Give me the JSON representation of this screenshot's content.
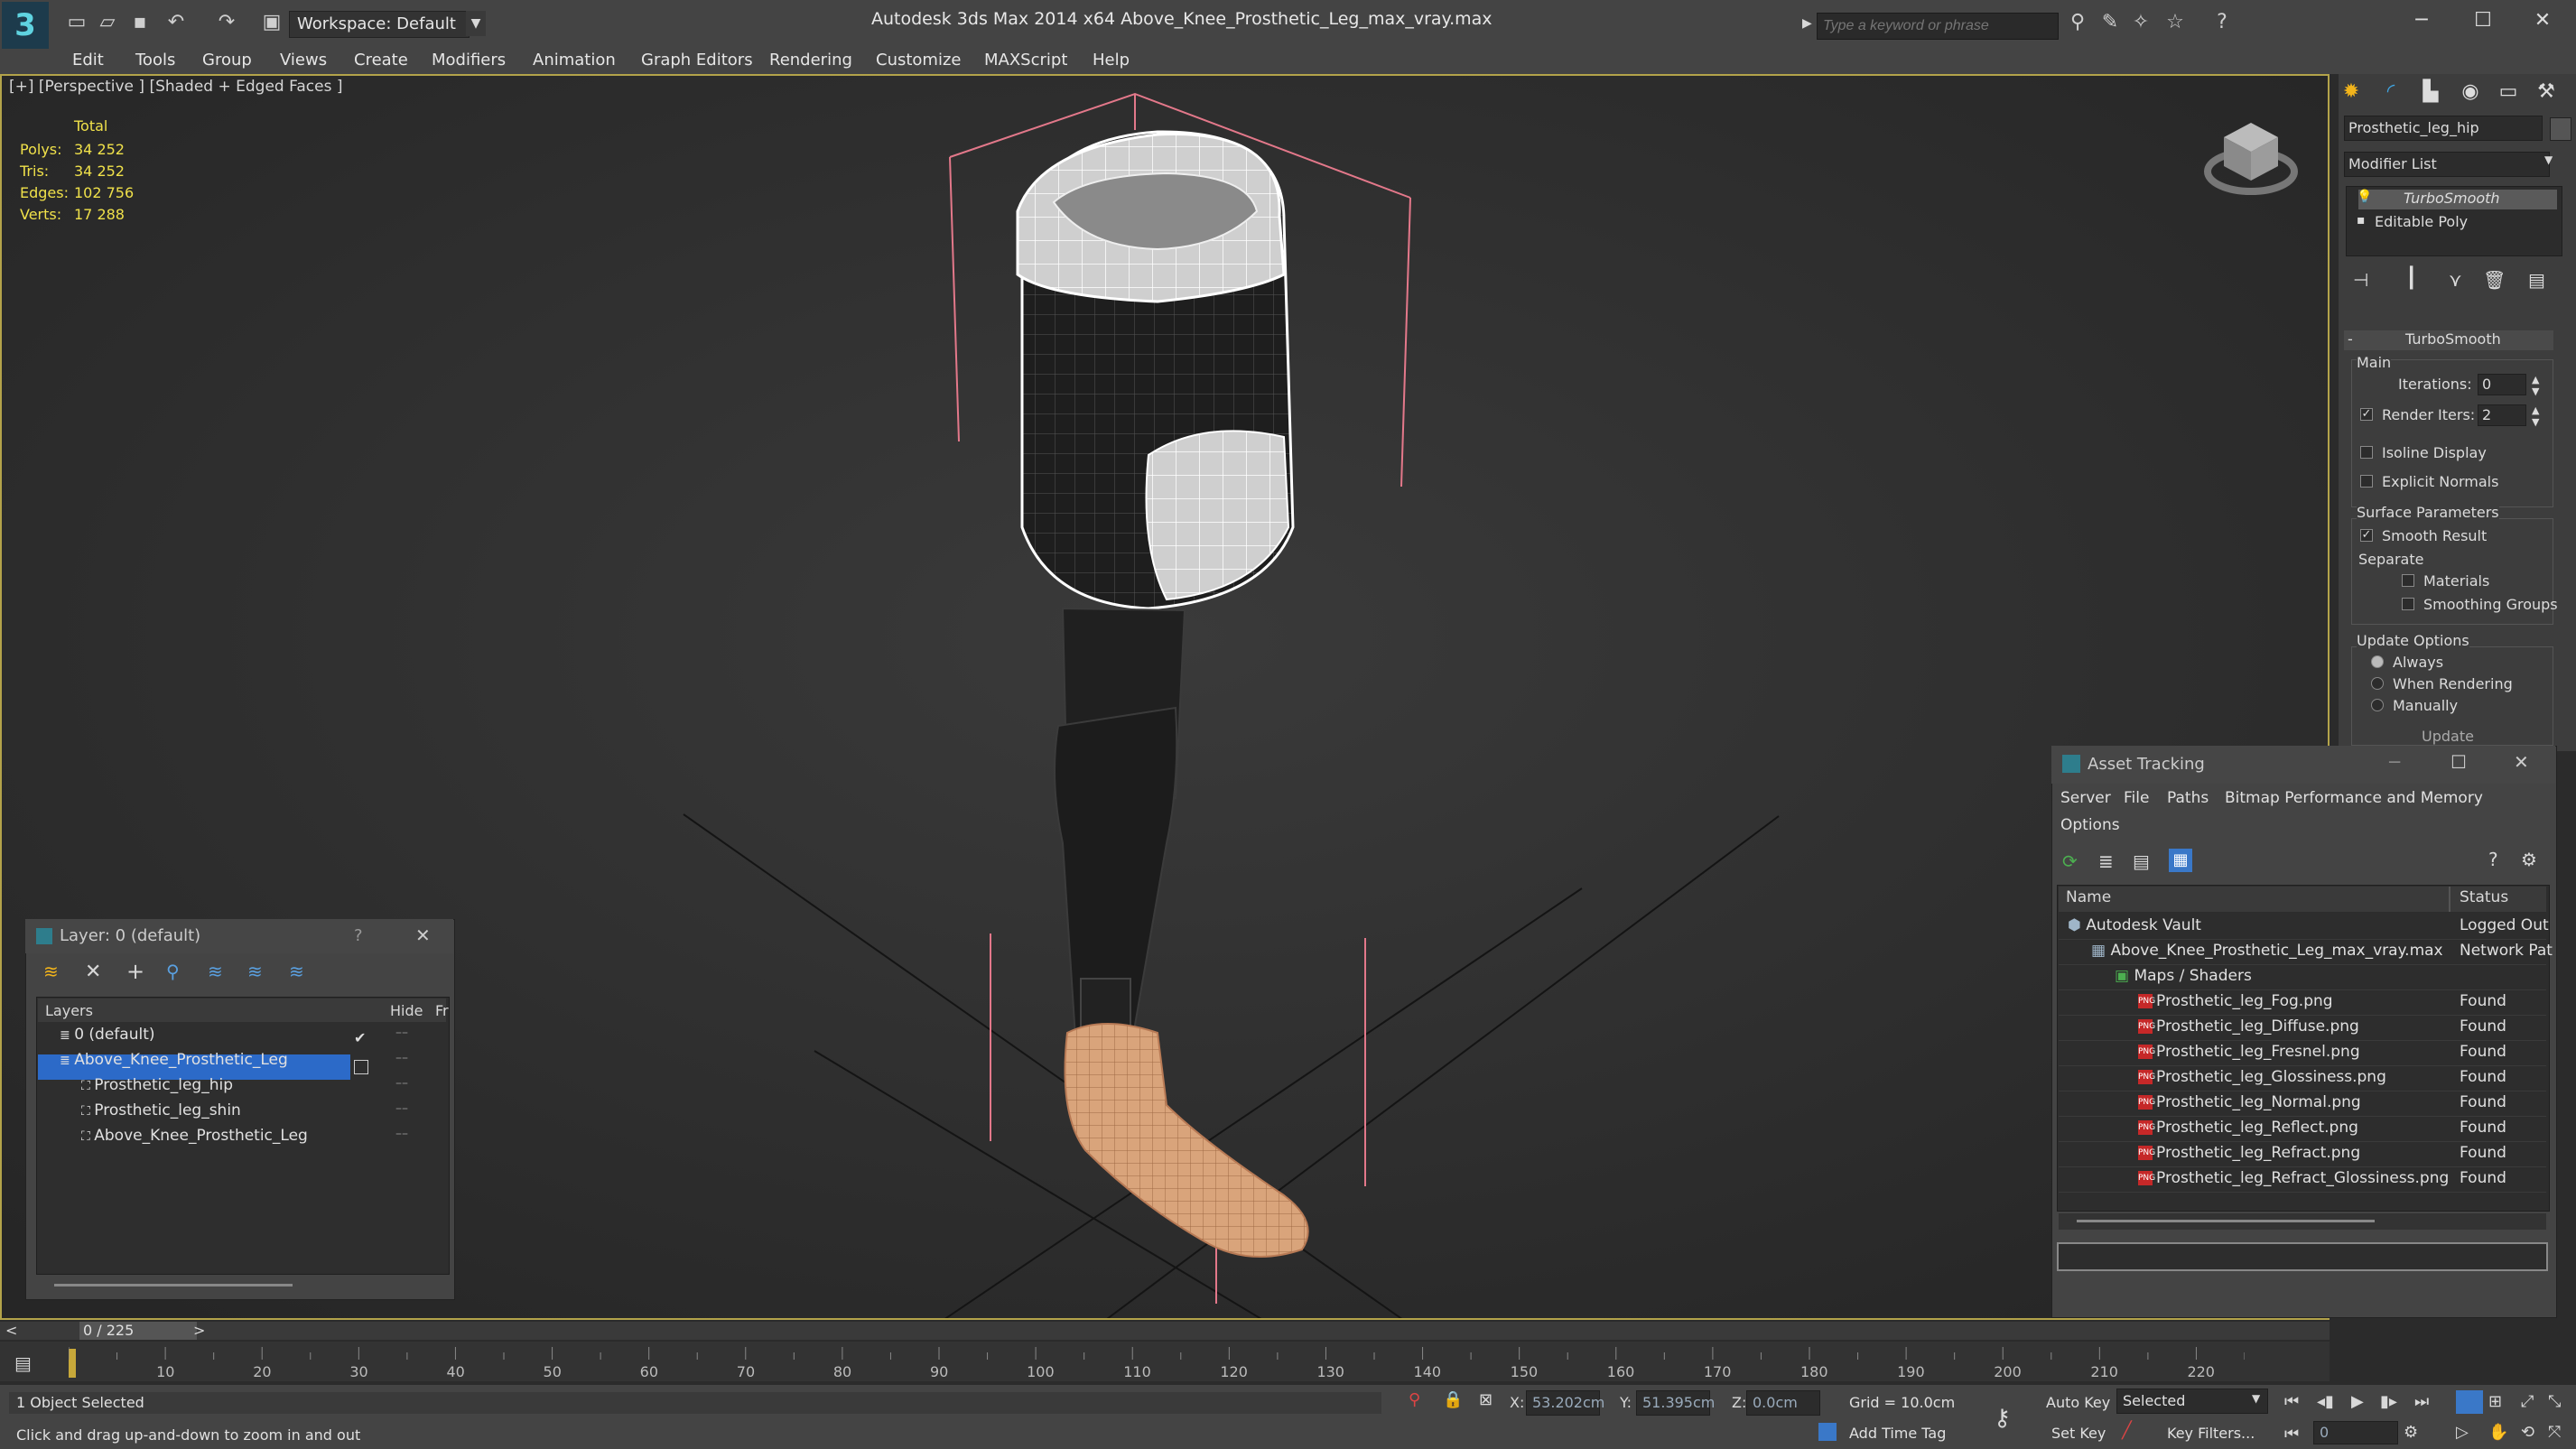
{
  "app": {
    "title": "Autodesk 3ds Max  2014 x64     Above_Knee_Prosthetic_Leg_max_vray.max",
    "workspace": "Workspace: Default",
    "search_placeholder": "Type a keyword or phrase"
  },
  "menus": [
    "Edit",
    "Tools",
    "Group",
    "Views",
    "Create",
    "Modifiers",
    "Animation",
    "Graph Editors",
    "Rendering",
    "Customize",
    "MAXScript",
    "Help"
  ],
  "viewport": {
    "label": "[+] [Perspective ] [Shaded + Edged Faces ]",
    "stats": {
      "header": "Total",
      "rows": [
        {
          "k": "Polys:",
          "v": "34 252"
        },
        {
          "k": "Tris:",
          "v": "34 252"
        },
        {
          "k": "Edges:",
          "v": "102 756"
        },
        {
          "k": "Verts:",
          "v": "17 288"
        }
      ]
    }
  },
  "command_panel": {
    "object_name": "Prosthetic_leg_hip",
    "modifier_list": "Modifier List",
    "stack": [
      "TurboSmooth",
      "Editable Poly"
    ],
    "rollout": "TurboSmooth",
    "main": "Main",
    "iterations_label": "Iterations:",
    "iterations": "0",
    "render_iters_label": "Render Iters:",
    "render_iters": "2",
    "isoline": "Isoline Display",
    "explicit_normals": "Explicit Normals",
    "surface_params": "Surface Parameters",
    "smooth_result": "Smooth Result",
    "separate": "Separate",
    "materials": "Materials",
    "smoothing_groups": "Smoothing Groups",
    "update_options": "Update Options",
    "always": "Always",
    "when_rendering": "When Rendering",
    "manually": "Manually",
    "update": "Update"
  },
  "asset_tracking": {
    "title": "Asset Tracking",
    "menus": [
      "Server",
      "File",
      "Paths",
      "Bitmap Performance and Memory"
    ],
    "menu2": "Options",
    "col_name": "Name",
    "col_status": "Status",
    "rows": [
      {
        "name": "Autodesk Vault",
        "status": "Logged Out",
        "indent": 0,
        "icon": "vault"
      },
      {
        "name": "Above_Knee_Prosthetic_Leg_max_vray.max",
        "status": "Network Pat",
        "indent": 1,
        "icon": "max"
      },
      {
        "name": "Maps / Shaders",
        "status": "",
        "indent": 2,
        "icon": "folder"
      },
      {
        "name": "Prosthetic_leg_Fog.png",
        "status": "Found",
        "indent": 3,
        "icon": "png"
      },
      {
        "name": "Prosthetic_leg_Diffuse.png",
        "status": "Found",
        "indent": 3,
        "icon": "png"
      },
      {
        "name": "Prosthetic_leg_Fresnel.png",
        "status": "Found",
        "indent": 3,
        "icon": "png"
      },
      {
        "name": "Prosthetic_leg_Glossiness.png",
        "status": "Found",
        "indent": 3,
        "icon": "png"
      },
      {
        "name": "Prosthetic_leg_Normal.png",
        "status": "Found",
        "indent": 3,
        "icon": "png"
      },
      {
        "name": "Prosthetic_leg_Reflect.png",
        "status": "Found",
        "indent": 3,
        "icon": "png"
      },
      {
        "name": "Prosthetic_leg_Refract.png",
        "status": "Found",
        "indent": 3,
        "icon": "png"
      },
      {
        "name": "Prosthetic_leg_Refract_Glossiness.png",
        "status": "Found",
        "indent": 3,
        "icon": "png"
      }
    ]
  },
  "layer_dialog": {
    "title": "Layer: 0 (default)",
    "help": "?",
    "col_layers": "Layers",
    "col_hide": "Hide",
    "col_fr": "Fr",
    "rows": [
      {
        "name": "0 (default)",
        "indent": 0
      },
      {
        "name": "Above_Knee_Prosthetic_Leg",
        "indent": 0
      },
      {
        "name": "Prosthetic_leg_hip",
        "indent": 1
      },
      {
        "name": "Prosthetic_leg_shin",
        "indent": 1
      },
      {
        "name": "Above_Knee_Prosthetic_Leg",
        "indent": 1
      }
    ]
  },
  "timeline": {
    "frame": "0 / 225",
    "ticks": [
      "10",
      "20",
      "30",
      "40",
      "50",
      "60",
      "70",
      "80",
      "90",
      "100",
      "110",
      "120",
      "130",
      "140",
      "150",
      "160",
      "170",
      "180",
      "190",
      "200",
      "210",
      "220"
    ]
  },
  "status": {
    "selected": "1 Object Selected",
    "prompt": "Click and drag up-and-down to zoom in and out",
    "x_label": "X:",
    "x": "53.202cm",
    "y_label": "Y:",
    "y": "51.395cm",
    "z_label": "Z:",
    "z": "0.0cm",
    "grid": "Grid = 10.0cm",
    "add_time_tag": "Add Time Tag",
    "auto_key": "Auto Key",
    "set_key": "Set Key",
    "selected_dropdown": "Selected",
    "key_filters": "Key Filters...",
    "frame_field": "0"
  }
}
